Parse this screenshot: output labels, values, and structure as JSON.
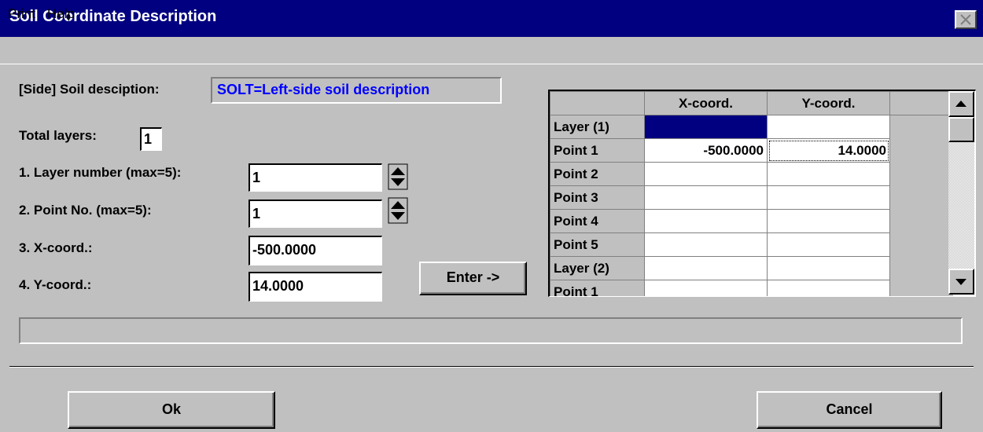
{
  "window": {
    "title": "Soil Coordinate Description"
  },
  "menu": {
    "items": [
      "Print",
      "Help"
    ]
  },
  "form": {
    "desc_label": "[Side] Soil desciption:",
    "desc_value": "SOLT=Left-side soil description",
    "total_layers_label": "Total layers:",
    "total_layers_value": "1",
    "layer_number_label": "1. Layer number (max=5):",
    "layer_number_value": "1",
    "point_no_label": "2. Point No. (max=5):",
    "point_no_value": "1",
    "x_label": "3. X-coord.:",
    "x_value": "-500.0000",
    "y_label": "4. Y-coord.:",
    "y_value": "14.0000",
    "enter_label": "Enter ->"
  },
  "grid": {
    "columns": [
      "",
      "X-coord.",
      "Y-coord.",
      ""
    ],
    "rows": [
      {
        "label": "Layer (1)",
        "x": "",
        "y": ""
      },
      {
        "label": "Point 1",
        "x": "-500.0000",
        "y": "14.0000"
      },
      {
        "label": "Point 2",
        "x": "",
        "y": ""
      },
      {
        "label": "Point 3",
        "x": "",
        "y": ""
      },
      {
        "label": "Point 4",
        "x": "",
        "y": ""
      },
      {
        "label": "Point 5",
        "x": "",
        "y": ""
      },
      {
        "label": "Layer (2)",
        "x": "",
        "y": ""
      },
      {
        "label": "Point 1",
        "x": "",
        "y": ""
      }
    ]
  },
  "buttons": {
    "ok": "Ok",
    "cancel": "Cancel"
  },
  "colors": {
    "titlebar": "#000080",
    "face": "#c0c0c0",
    "desc_text": "#0000ff"
  }
}
